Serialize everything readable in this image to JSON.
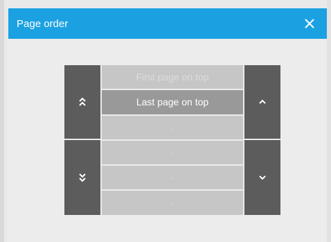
{
  "dialog": {
    "title": "Page order",
    "close_label": "✕"
  },
  "picker": {
    "options": [
      "First page on top",
      "Last page on top",
      "-",
      "-",
      "-",
      "-"
    ],
    "selected": "Last page on top"
  },
  "colors": {
    "title_bar": "#1ba1e2",
    "side_buttons": "#5c5c5c",
    "row_bg": "#c6c6c6",
    "row_selected_bg": "#999999"
  },
  "icons": {
    "close": "close-icon",
    "move_to_top": "double-chevron-up-icon",
    "move_to_bottom": "double-chevron-down-icon",
    "move_up": "chevron-up-icon",
    "move_down": "chevron-down-icon"
  }
}
